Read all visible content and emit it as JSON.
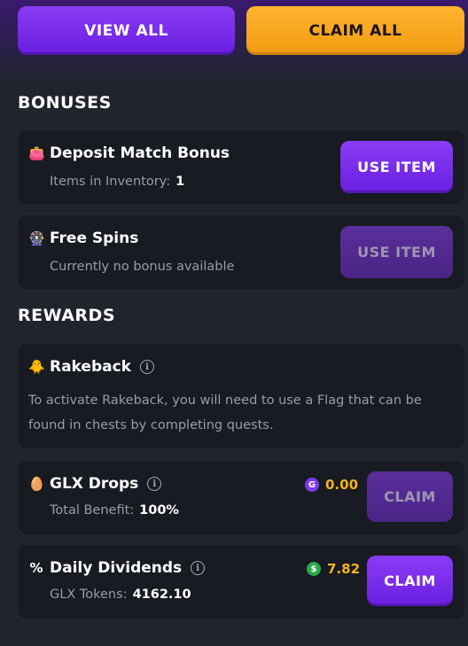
{
  "header": {
    "view_all_label": "VIEW ALL",
    "claim_all_label": "CLAIM ALL"
  },
  "bonuses": {
    "title": "BONUSES",
    "items": [
      {
        "icon": "wallet-icon",
        "name": "Deposit Match Bonus",
        "sub_label": "Items in Inventory:",
        "sub_value": "1",
        "button_label": "USE ITEM",
        "button_enabled": true
      },
      {
        "icon": "spin-wheel-icon",
        "name": "Free Spins",
        "sub_label": "Currently no bonus available",
        "button_label": "USE ITEM",
        "button_enabled": false
      }
    ]
  },
  "rewards": {
    "title": "REWARDS",
    "rakeback": {
      "icon": "chicken-icon",
      "name": "Rakeback",
      "description": "To activate Rakeback, you will need to use a Flag that can be found in chests by completing quests."
    },
    "glx_drops": {
      "icon": "egg-icon",
      "name": "GLX Drops",
      "sub_label": "Total Benefit:",
      "sub_value": "100%",
      "amount": "0.00",
      "amount_icon": "glx-coin-icon",
      "button_label": "CLAIM",
      "button_enabled": false
    },
    "daily_dividends": {
      "icon": "percent-icon",
      "name": "Daily Dividends",
      "sub_label": "GLX Tokens:",
      "sub_value": "4162.10",
      "amount": "7.82",
      "amount_icon": "dollar-coin-icon",
      "button_label": "CLAIM",
      "button_enabled": true
    }
  },
  "colors": {
    "background": "#21242d",
    "card": "#181b22",
    "purple": "#7a2ff0",
    "orange": "#f5a623",
    "amount": "#f5b11e",
    "muted_text": "#9a9ca8"
  }
}
